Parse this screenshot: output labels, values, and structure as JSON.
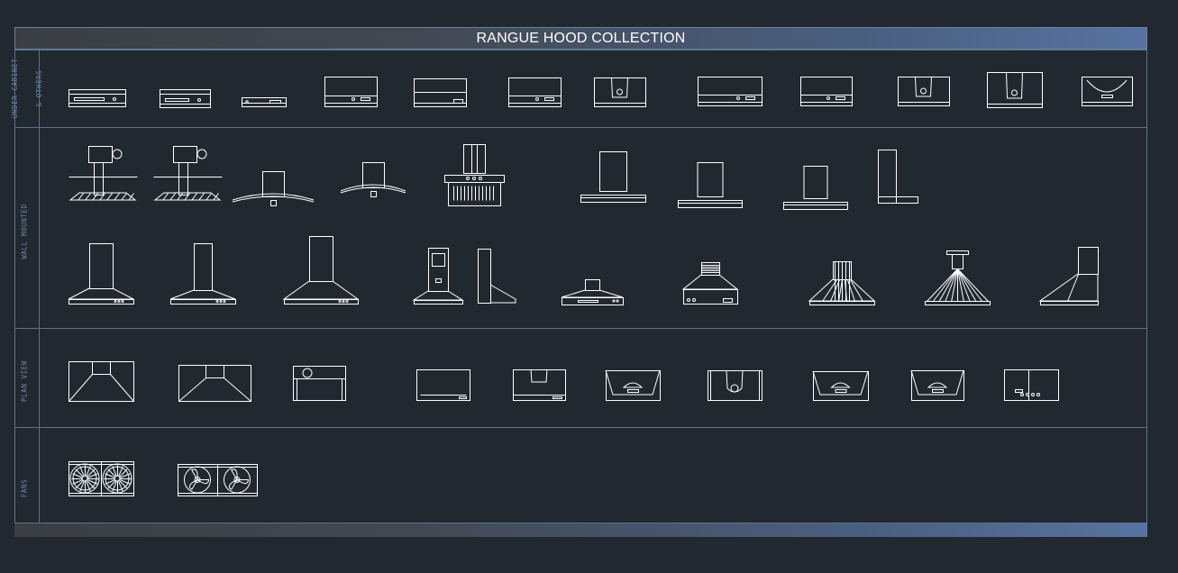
{
  "title": "RANGUE HOOD COLLECTION",
  "sections": [
    {
      "label_lines": [
        "UNDER CABINET",
        "& OTHERS"
      ]
    },
    {
      "label_lines": [
        "WALL MOUNTED"
      ]
    },
    {
      "label_lines": [
        "PLAN VIEW"
      ]
    },
    {
      "label_lines": [
        "FANS"
      ]
    }
  ],
  "colors": {
    "background": "#212830",
    "frame_line": "#5d718c",
    "drawing_line": "#ffffff",
    "label_text": "#6f86a8"
  },
  "icons": {
    "under_cabinet": [
      "hood-slim-icon",
      "hood-slim-icon",
      "hood-slim-icon",
      "hood-box-icon",
      "hood-box-icon",
      "hood-box-icon",
      "hood-box-icon",
      "hood-box-icon",
      "hood-box-icon",
      "hood-box-icon",
      "hood-box-icon",
      "hood-box-icon"
    ],
    "wall_row_1": [
      "island-hood-icon",
      "island-hood-icon",
      "curved-glass-hood-icon",
      "curved-glass-hood-icon",
      "angled-hood-icon",
      "t-shape-hood-icon",
      "t-shape-hood-icon",
      "t-shape-hood-icon",
      "side-profile-hood-icon"
    ],
    "wall_row_2": [
      "pyramid-hood-icon",
      "pyramid-hood-icon",
      "pyramid-hood-icon",
      "chimney-hood-icon",
      "side-profile-hood-icon",
      "low-pyramid-hood-icon",
      "low-pyramid-hood-icon",
      "fluted-hood-icon",
      "fan-rib-hood-icon",
      "wall-profile-hood-icon"
    ],
    "plan_view": [
      "plan-hood-icon",
      "plan-hood-icon",
      "plan-hood-icon",
      "plan-hood-icon",
      "plan-hood-icon",
      "plan-hood-icon",
      "plan-hood-icon",
      "plan-hood-icon",
      "plan-hood-icon",
      "plan-hood-icon"
    ],
    "fans": [
      "double-fan-icon",
      "double-fan-icon"
    ]
  }
}
